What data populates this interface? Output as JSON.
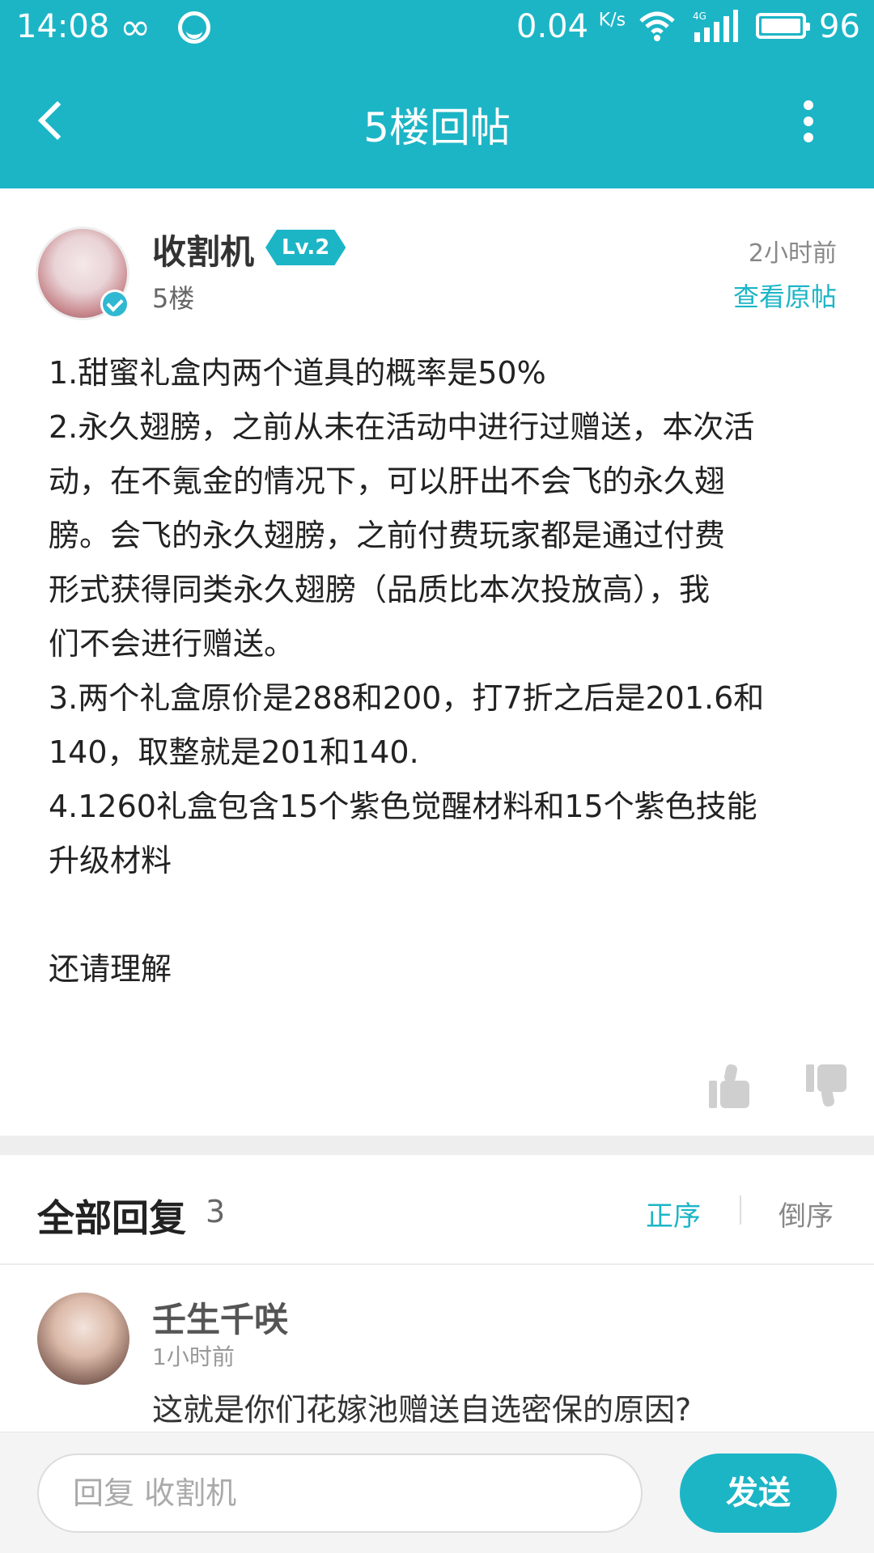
{
  "status_bar": {
    "time": "14:08",
    "loop_glyph": "∞",
    "speed": "0.04",
    "speed_unit": "K/s",
    "network": "4G",
    "battery": "96"
  },
  "header": {
    "title": "5楼回帖"
  },
  "post": {
    "author": "收割机",
    "level": "Lv.2",
    "floor": "5楼",
    "time": "2小时前",
    "view_original": "查看原帖",
    "body": "1.甜蜜礼盒内两个道具的概率是50%\n2.永久翅膀，之前从未在活动中进行过赠送，本次活\n动，在不氪金的情况下，可以肝出不会飞的永久翅\n膀。会飞的永久翅膀，之前付费玩家都是通过付费\n形式获得同类永久翅膀（品质比本次投放高），我\n们不会进行赠送。\n3.两个礼盒原价是288和200，打7折之后是201.6和\n140，取整就是201和140.\n4.1260礼盒包含15个紫色觉醒材料和15个紫色技能\n升级材料\n\n还请理解"
  },
  "replies": {
    "title": "全部回复",
    "count": "3",
    "sort_asc": "正序",
    "sort_desc": "倒序",
    "items": [
      {
        "name": "壬生千咲",
        "time": "1小时前",
        "text": "这就是你们花嫁池赠送自选密保的原因?"
      }
    ]
  },
  "bottom": {
    "placeholder": "回复 收割机",
    "send_label": "发送"
  },
  "colors": {
    "accent": "#1cb5c6"
  }
}
